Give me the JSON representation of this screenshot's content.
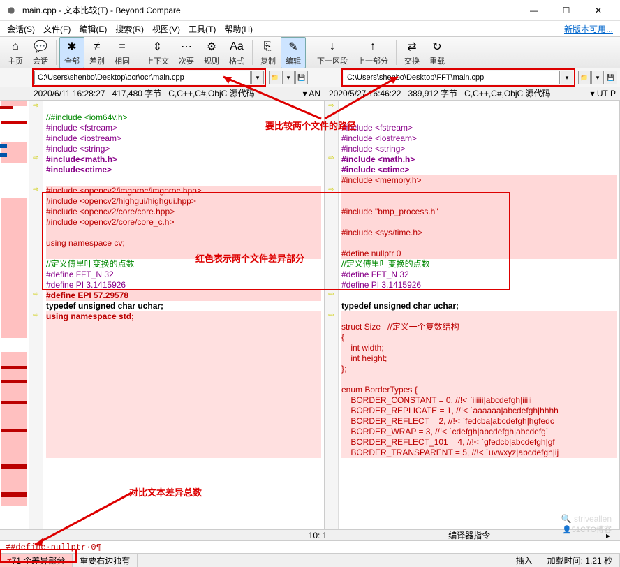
{
  "title": "main.cpp - 文本比较(T) - Beyond Compare",
  "menu": [
    "会话(S)",
    "文件(F)",
    "编辑(E)",
    "搜索(R)",
    "视图(V)",
    "工具(T)",
    "帮助(H)"
  ],
  "new_version": "新版本可用...",
  "toolbar": [
    {
      "label": "主页",
      "icon": "⌂"
    },
    {
      "label": "会话",
      "icon": "💬"
    },
    {
      "label": "全部",
      "icon": "✱",
      "active": true
    },
    {
      "label": "差别",
      "icon": "≠"
    },
    {
      "label": "相同",
      "icon": "="
    },
    {
      "label": "上下文",
      "icon": "⇕"
    },
    {
      "label": "次要",
      "icon": "⋯"
    },
    {
      "label": "规则",
      "icon": "⚙"
    },
    {
      "label": "格式",
      "icon": "Aa"
    },
    {
      "label": "复制",
      "icon": "⎘"
    },
    {
      "label": "编辑",
      "icon": "✎",
      "active": true
    },
    {
      "label": "下一区段",
      "icon": "↓"
    },
    {
      "label": "上一部分",
      "icon": "↑"
    },
    {
      "label": "交换",
      "icon": "⇄"
    },
    {
      "label": "重载",
      "icon": "↻"
    }
  ],
  "paths": {
    "left": "C:\\Users\\shenbo\\Desktop\\ocr\\ocr\\main.cpp",
    "right": "C:\\Users\\shenbo\\Desktop\\FFT\\main.cpp"
  },
  "info": {
    "left": {
      "date": "2020/6/11 16:28:27",
      "size": "417,480 字节",
      "type": "C,C++,C#,ObjC 源代码",
      "enc": "AN"
    },
    "right": {
      "date": "2020/5/27 16:46:22",
      "size": "389,912 字节",
      "type": "C,C++,C#,ObjC 源代码",
      "enc": "UT  P"
    }
  },
  "annotations": {
    "path_label": "要比较两个文件的路径",
    "diff_label": "红色表示两个文件差异部分",
    "count_label": "对比文本差异总数"
  },
  "code": {
    "left": [
      {
        "t": "",
        "c": ""
      },
      {
        "t": "//#include <iom64v.h>",
        "c": "cmt"
      },
      {
        "t": "#include <fstream>",
        "c": "pp"
      },
      {
        "t": "#include <iostream>",
        "c": "pp"
      },
      {
        "t": "#include <string>",
        "c": "pp"
      },
      {
        "t": "#include<math.h>",
        "c": "pp bold"
      },
      {
        "t": "#include<ctime>",
        "c": "pp bold"
      },
      {
        "t": "",
        "c": ""
      },
      {
        "t": "#include <opencv2/imgproc/imgproc.hpp>",
        "c": "red",
        "d": 1
      },
      {
        "t": "#include <opencv2/highgui/highgui.hpp>",
        "c": "red",
        "d": 1
      },
      {
        "t": "#include <opencv2/core/core.hpp>",
        "c": "red",
        "d": 1
      },
      {
        "t": "#include <opencv2/core/core_c.h>",
        "c": "red",
        "d": 1
      },
      {
        "t": "",
        "c": "",
        "d": 1
      },
      {
        "t": "using namespace cv;",
        "c": "red",
        "d": 1
      },
      {
        "t": "",
        "c": "",
        "d": 1
      },
      {
        "t": "//定义傅里叶变换的点数",
        "c": "cmt"
      },
      {
        "t": "#define FFT_N 32",
        "c": "pp"
      },
      {
        "t": "#define PI 3.1415926",
        "c": "pp"
      },
      {
        "t": "#define EPI 57.29578",
        "c": "red bold",
        "d": 1
      },
      {
        "t": "typedef unsigned char uchar;",
        "c": "bold"
      },
      {
        "t": "using namespace std;",
        "c": "red bold",
        "d": 2
      },
      {
        "t": "",
        "c": "",
        "d": 2
      },
      {
        "t": "",
        "c": "",
        "d": 2
      },
      {
        "t": "",
        "c": "",
        "d": 2
      },
      {
        "t": "",
        "c": "",
        "d": 2
      },
      {
        "t": "",
        "c": "",
        "d": 2
      },
      {
        "t": "",
        "c": "",
        "d": 2
      },
      {
        "t": "",
        "c": "",
        "d": 2
      },
      {
        "t": "",
        "c": "",
        "d": 2
      },
      {
        "t": "",
        "c": "",
        "d": 2
      },
      {
        "t": "",
        "c": "",
        "d": 2
      },
      {
        "t": "",
        "c": "",
        "d": 2
      },
      {
        "t": "",
        "c": "",
        "d": 2
      },
      {
        "t": "",
        "c": "",
        "d": 2
      }
    ],
    "right": [
      {
        "t": "",
        "c": ""
      },
      {
        "t": "",
        "c": ""
      },
      {
        "t": "#include <fstream>",
        "c": "pp"
      },
      {
        "t": "#include <iostream>",
        "c": "pp"
      },
      {
        "t": "#include <string>",
        "c": "pp"
      },
      {
        "t": "#include <math.h>",
        "c": "pp bold"
      },
      {
        "t": "#include <ctime>",
        "c": "pp bold"
      },
      {
        "t": "#include <memory.h>",
        "c": "red",
        "d": 1
      },
      {
        "t": "",
        "c": "",
        "d": 1
      },
      {
        "t": "",
        "c": "",
        "d": 1
      },
      {
        "t": "#include \"bmp_process.h\"",
        "c": "red",
        "d": 1
      },
      {
        "t": "",
        "c": "",
        "d": 1
      },
      {
        "t": "#include <sys/time.h>",
        "c": "red",
        "d": 1
      },
      {
        "t": "",
        "c": "",
        "d": 1
      },
      {
        "t": "#define nullptr 0",
        "c": "red",
        "d": 1
      },
      {
        "t": "//定义傅里叶变换的点数",
        "c": "cmt"
      },
      {
        "t": "#define FFT_N 32",
        "c": "pp"
      },
      {
        "t": "#define PI 3.1415926",
        "c": "pp"
      },
      {
        "t": "",
        "c": ""
      },
      {
        "t": "typedef unsigned char uchar;",
        "c": "bold"
      },
      {
        "t": "",
        "c": "",
        "d": 2
      },
      {
        "t": "struct Size   //定义一个复数结构",
        "c": "red",
        "d": 2
      },
      {
        "t": "{",
        "c": "red",
        "d": 2
      },
      {
        "t": "    int width;",
        "c": "red",
        "d": 2
      },
      {
        "t": "    int height;",
        "c": "red",
        "d": 2
      },
      {
        "t": "};",
        "c": "red",
        "d": 2
      },
      {
        "t": "",
        "c": "",
        "d": 2
      },
      {
        "t": "enum BorderTypes {",
        "c": "red",
        "d": 2
      },
      {
        "t": "    BORDER_CONSTANT = 0, //!< `iiiiii|abcdefgh|iiiii",
        "c": "red",
        "d": 2
      },
      {
        "t": "    BORDER_REPLICATE = 1, //!< `aaaaaa|abcdefgh|hhhh",
        "c": "red",
        "d": 2
      },
      {
        "t": "    BORDER_REFLECT = 2, //!< `fedcba|abcdefgh|hgfedc",
        "c": "red",
        "d": 2
      },
      {
        "t": "    BORDER_WRAP = 3, //!< `cdefgh|abcdefgh|abcdefg`",
        "c": "red",
        "d": 2
      },
      {
        "t": "    BORDER_REFLECT_101 = 4, //!< `gfedcb|abcdefgh|gf",
        "c": "red",
        "d": 2
      },
      {
        "t": "    BORDER_TRANSPARENT = 5, //!< `uvwxyz|abcdefgh|ij",
        "c": "red",
        "d": 2
      }
    ]
  },
  "bottom_cursor": "≠#define·nullptr·0¶",
  "scroll": {
    "pos": "10: 1",
    "label": "编译器指令"
  },
  "status": {
    "diff": "71 个差异部分",
    "right_only": "重要右边独有",
    "insert": "插入",
    "load": "加载时间: 1.21 秒"
  },
  "watermark": "🔍 striveallen",
  "watermark2": "👤51CTO博客"
}
